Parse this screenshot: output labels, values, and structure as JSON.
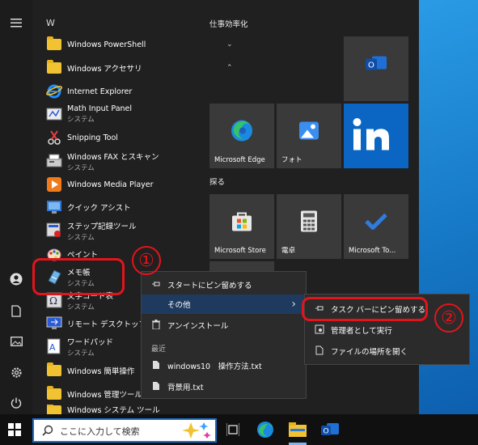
{
  "start_menu": {
    "section_letter": "W",
    "apps": [
      {
        "name": "Windows PowerShell",
        "sub": "",
        "icon": "folder-icon",
        "chevron": "⌄"
      },
      {
        "name": "Windows アクセサリ",
        "sub": "",
        "icon": "folder-icon",
        "chevron": "⌃"
      },
      {
        "name": "Internet Explorer",
        "sub": "",
        "icon": "internet-explorer-icon"
      },
      {
        "name": "Math Input Panel",
        "sub": "システム",
        "icon": "math-input-icon"
      },
      {
        "name": "Snipping Tool",
        "sub": "",
        "icon": "snipping-tool-icon"
      },
      {
        "name": "Windows FAX とスキャン",
        "sub": "システム",
        "icon": "fax-icon"
      },
      {
        "name": "Windows Media Player",
        "sub": "",
        "icon": "media-player-icon"
      },
      {
        "name": "クイック アシスト",
        "sub": "",
        "icon": "quick-assist-icon"
      },
      {
        "name": "ステップ記録ツール",
        "sub": "システム",
        "icon": "steps-recorder-icon"
      },
      {
        "name": "ペイント",
        "sub": "",
        "icon": "paint-icon"
      },
      {
        "name": "メモ帳",
        "sub": "システム",
        "icon": "notepad-icon"
      },
      {
        "name": "文字コード表",
        "sub": "システム",
        "icon": "charmap-icon"
      },
      {
        "name": "リモート デスクトップ接続",
        "sub": "",
        "icon": "remote-desktop-icon"
      },
      {
        "name": "ワードパッド",
        "sub": "システム",
        "icon": "wordpad-icon"
      },
      {
        "name": "Windows 簡単操作",
        "sub": "",
        "icon": "folder-icon",
        "chevron": "⌄"
      },
      {
        "name": "Windows 管理ツール",
        "sub": "",
        "icon": "folder-icon",
        "chevron": "⌄"
      },
      {
        "name": "Windows システム ツール",
        "sub": "",
        "icon": "folder-icon",
        "chevron": "⌄"
      }
    ],
    "groups": [
      {
        "title": "仕事効率化"
      },
      {
        "title": "探る"
      }
    ],
    "tiles": [
      {
        "label": "Microsoft Edge"
      },
      {
        "label": "フォト"
      },
      {
        "label": "Microsoft Store"
      },
      {
        "label": "電卓"
      },
      {
        "label": "Microsoft To..."
      }
    ]
  },
  "context_menu": {
    "items": [
      {
        "label": "スタートにピン留めする",
        "icon": "pin-icon"
      },
      {
        "label": "その他",
        "icon": "",
        "arrow": "›"
      },
      {
        "label": "アンインストール",
        "icon": "trash-icon"
      }
    ],
    "recent_header": "最近",
    "recent": [
      {
        "label": "windows10　操作方法.txt"
      },
      {
        "label": "背景用.txt"
      }
    ]
  },
  "submenu": {
    "items": [
      {
        "label": "タスク バーにピン留めする"
      },
      {
        "label": "管理者として実行"
      },
      {
        "label": "ファイルの場所を開く"
      }
    ]
  },
  "annotations": {
    "one": "①",
    "two": "②"
  },
  "taskbar": {
    "search_placeholder": "ここに入力して検索"
  },
  "colors": {
    "highlight_red": "#e4141b",
    "start_bg": "#202020",
    "tile_bg": "#3a3a3a",
    "linkedin_blue": "#0a66c2",
    "menu_selected": "#1e3a5f"
  }
}
